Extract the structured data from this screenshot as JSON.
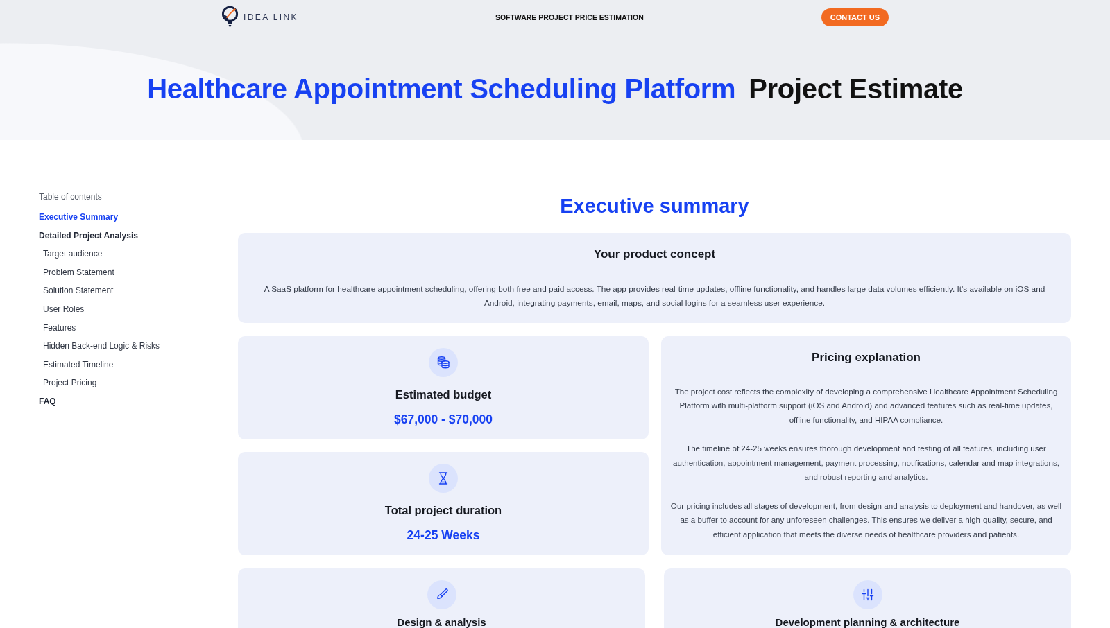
{
  "header": {
    "logo": "IDEA LINK",
    "tagline": "SOFTWARE PROJECT PRICE ESTIMATION",
    "contact_button": "CONTACT US"
  },
  "hero": {
    "title_highlight": "Healthcare Appointment Scheduling Platform",
    "title_rest": "Project Estimate"
  },
  "sidebar": {
    "heading": "Table of contents",
    "items": [
      {
        "label": "Executive Summary",
        "selected": true
      },
      {
        "label": "Detailed Project Analysis",
        "selected": false,
        "children": [
          {
            "label": "Target audience",
            "selected": false
          },
          {
            "label": "Problem Statement",
            "selected": false
          },
          {
            "label": "Solution Statement",
            "selected": false
          },
          {
            "label": "User Roles",
            "selected": false
          },
          {
            "label": "Features",
            "selected": false
          },
          {
            "label": "Hidden Back-end Logic & Risks",
            "selected": false
          },
          {
            "label": "Estimated Timeline",
            "selected": false
          },
          {
            "label": "Project Pricing",
            "selected": false
          }
        ]
      },
      {
        "label": "FAQ",
        "selected": false
      }
    ]
  },
  "summary": {
    "title": "Executive summary",
    "concept": {
      "title": "Your product concept",
      "text": "A SaaS platform for healthcare appointment scheduling, offering both free and paid access. The app provides real-time updates, offline functionality, and handles large data volumes efficiently. It's available on iOS and Android, integrating payments, email, maps, and social logins for a seamless user experience."
    },
    "stats": [
      {
        "kind": "budget",
        "title": "Estimated budget",
        "value": "$67,000 - $70,000"
      },
      {
        "kind": "duration",
        "title": "Total project duration",
        "value": "24-25 Weeks"
      }
    ],
    "pricing": {
      "title": "Pricing explanation",
      "paragraphs": [
        "The project cost reflects the complexity of developing a comprehensive Healthcare Appointment Scheduling Platform with multi-platform support (iOS and Android) and advanced features such as real-time updates, offline functionality, and HIPAA compliance.",
        "The timeline of 24-25 weeks ensures thorough development and testing of all features, including user authentication, appointment management, payment processing, notifications, calendar and map integrations, and robust reporting and analytics.",
        "Our pricing includes all stages of development, from design and analysis to deployment and handover, as well as a buffer to account for any unforeseen challenges. This ensures we deliver a high-quality, secure, and efficient application that meets the diverse needs of healthcare providers and patients."
      ]
    },
    "phases": [
      {
        "kind": "design",
        "title": "Design & analysis"
      },
      {
        "kind": "development",
        "title": "Development planning & architecture"
      }
    ]
  }
}
